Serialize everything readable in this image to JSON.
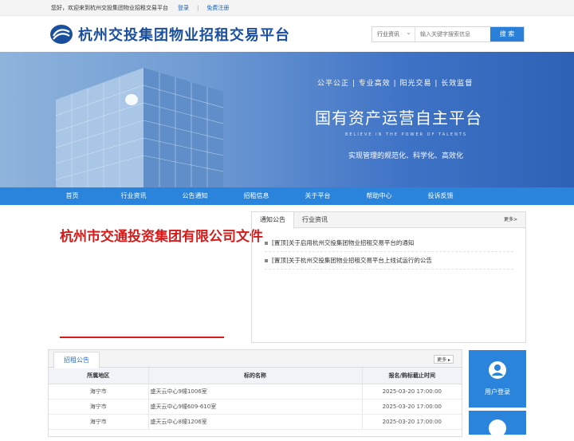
{
  "topbar": {
    "welcome": "您好，欢迎来到杭州交投集团物业招租交易平台",
    "login": "登录",
    "separator": "|",
    "register": "免费注册"
  },
  "header": {
    "logo_text": "杭州交投集团物业招租交易平台"
  },
  "search": {
    "category": "行业资讯",
    "placeholder": "输入关键字搜索信息",
    "button": "搜 索"
  },
  "banner": {
    "slogan1": "公平公正 | 专业高效 | 阳光交易 | 长效监督",
    "slogan2": "国有资产运营自主平台",
    "slogan3": "BELIEVE IN THE POWER OF TALENTS",
    "slogan4": "实现管理的规范化、科学化、高效化"
  },
  "nav": [
    "首页",
    "行业资讯",
    "公告通知",
    "招租信息",
    "关于平台",
    "帮助中心",
    "投诉反馈"
  ],
  "document": {
    "title": "杭州市交通投资集团有限公司文件"
  },
  "notice": {
    "tabs": [
      "通知公告",
      "行业资讯"
    ],
    "more": "更多>",
    "items": [
      "[置顶]关于启用杭州交投集团物业招租交易平台的通知",
      "[置顶]关于杭州交投集团物业招租交易平台上线试运行的公告"
    ]
  },
  "bid": {
    "title": "招租公告",
    "more": "更多",
    "columns": [
      "所属地区",
      "标的名称",
      "报名/购标截止时间"
    ],
    "rows": [
      [
        "海宁市",
        "盛天云中心9幢1006室",
        "2025-03-20 17:00:00"
      ],
      [
        "海宁市",
        "盛天云中心9幢609-610室",
        "2025-03-20 17:00:00"
      ],
      [
        "海宁市",
        "盛天云中心8幢1206室",
        "2025-03-20 17:00:00"
      ]
    ]
  },
  "side": {
    "user_login": "用户登录"
  },
  "colors": {
    "primary": "#2a84db",
    "logo": "#1a4f9e",
    "red": "#d61b1b"
  }
}
